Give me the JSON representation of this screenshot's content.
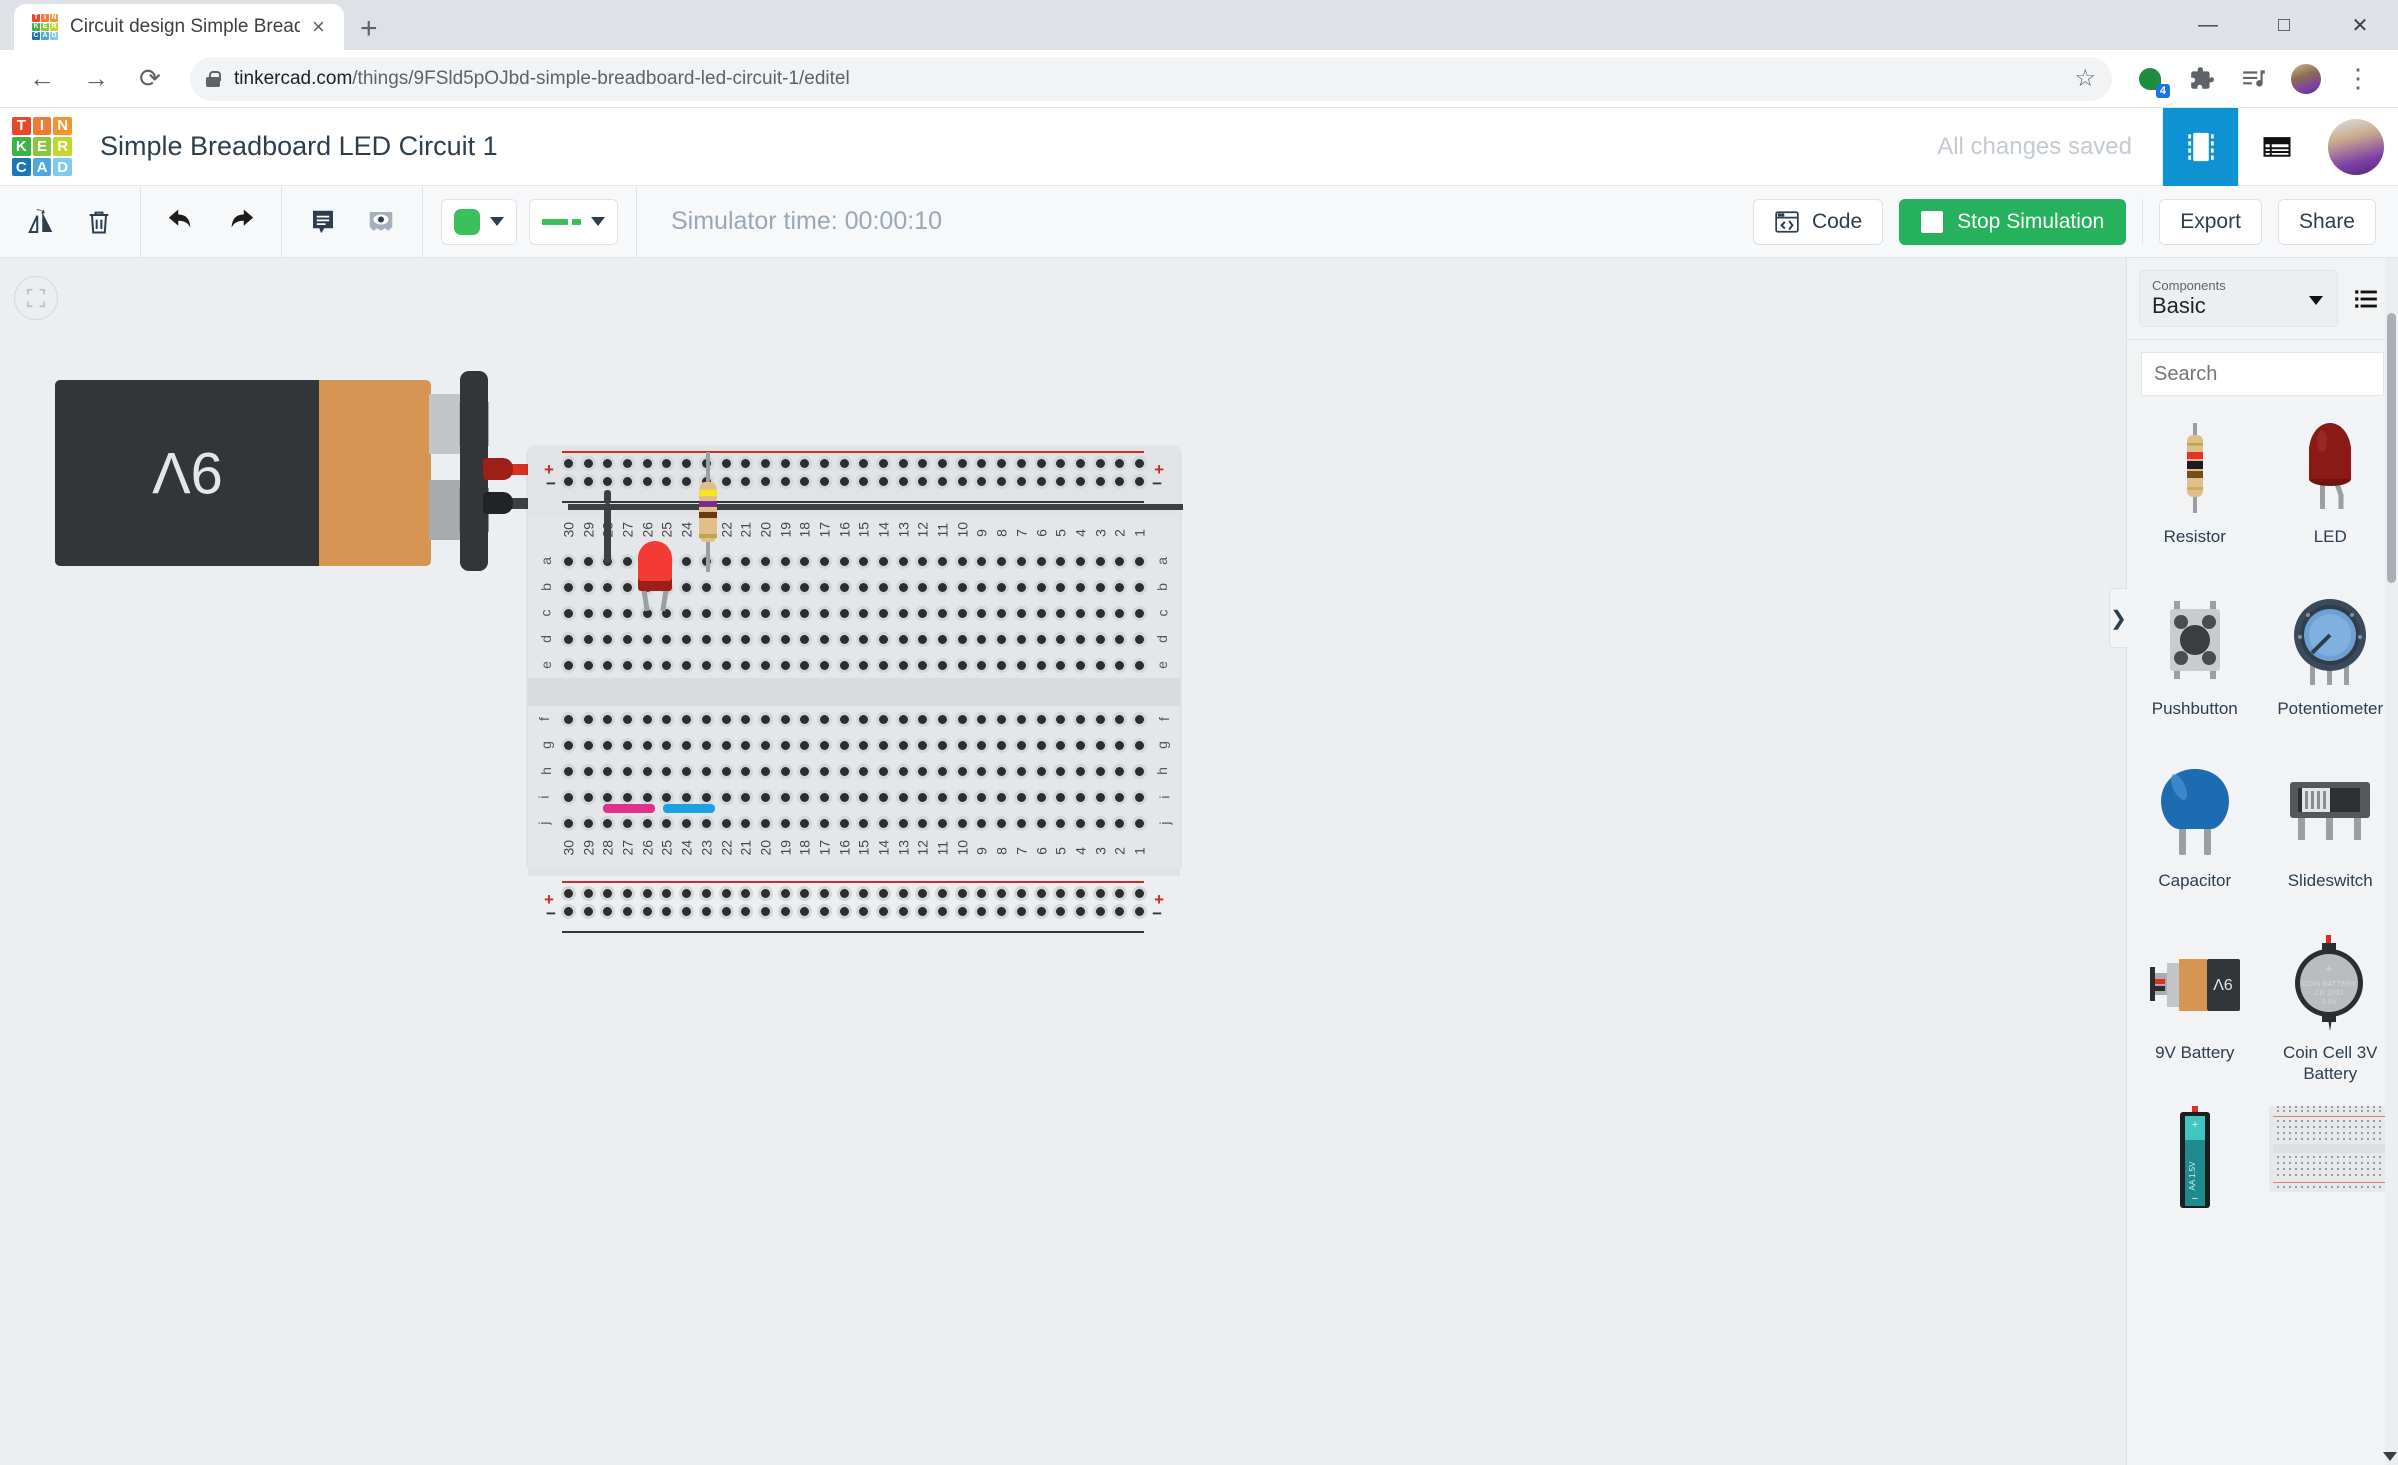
{
  "browser": {
    "tab": {
      "title": "Circuit design Simple Breadboard",
      "close_label": "×",
      "favicon_letters": [
        "T",
        "I",
        "N",
        "K",
        "E",
        "R",
        "C",
        "A",
        "D"
      ]
    },
    "newtab_label": "+",
    "window_controls": {
      "minimize": "—",
      "maximize": "□",
      "close": "✕"
    },
    "nav": {
      "back": "←",
      "forward": "→",
      "reload": "⟳"
    },
    "url_domain": "tinkercad.com",
    "url_path": "/things/9FSld5pOJbd-simple-breadboard-led-circuit-1/editel",
    "bookmark_label": "☆",
    "extension_badge": "4",
    "menu_label": "⋮"
  },
  "header": {
    "logo_letters": [
      "T",
      "I",
      "N",
      "K",
      "E",
      "R",
      "C",
      "A",
      "D"
    ],
    "logo_colors": [
      "#e8472b",
      "#f07a38",
      "#f59331",
      "#3db44a",
      "#8cc63f",
      "#c4d52e",
      "#1b75bb",
      "#4fa8dd",
      "#7ecbf0"
    ],
    "title": "Simple Breadboard LED Circuit 1",
    "save_status": "All changes saved",
    "view_circuit_label": "circuit-view-icon",
    "view_list_label": "list-view-icon"
  },
  "toolbar": {
    "rotate_label": "Rotate",
    "delete_label": "Delete",
    "undo_label": "Undo",
    "redo_label": "Redo",
    "notes_label": "Notes",
    "visibility_label": "Show/Hide",
    "color_value": "#3ac15b",
    "wire_color_value": "#3ac15b",
    "simulator_time": "Simulator time: 00:00:10",
    "code_label": "Code",
    "stop_label": "Stop Simulation",
    "stop_color": "#26b25d",
    "export_label": "Export",
    "share_label": "Share"
  },
  "canvas": {
    "fit_label": "Fit to view",
    "battery": {
      "label": "9V"
    },
    "breadboard": {
      "columns_top": [
        "30",
        "29",
        "28",
        "27",
        "26",
        "25",
        "24",
        "23",
        "22",
        "21",
        "20",
        "19",
        "18",
        "17",
        "16",
        "15",
        "14",
        "13",
        "12",
        "11",
        "10",
        "9",
        "8",
        "7",
        "6",
        "5",
        "4",
        "3",
        "2",
        "1"
      ],
      "rows_upper": [
        "a",
        "b",
        "c",
        "d",
        "e"
      ],
      "rows_lower": [
        "f",
        "g",
        "h",
        "i",
        "j"
      ],
      "rail_plus": "+",
      "rail_minus": "−"
    },
    "components_on_board": [
      {
        "name": "LED",
        "color": "#f43a34"
      },
      {
        "name": "Resistor",
        "bands": [
          "#f5e620",
          "#7b2d8e",
          "#6b3a12",
          "#b9a84a"
        ]
      },
      {
        "name": "Jumper wire pink",
        "color": "#e0308e"
      },
      {
        "name": "Jumper wire blue",
        "color": "#1aa3e0"
      }
    ]
  },
  "panel": {
    "collapse_label": "❯",
    "select_label": "Components",
    "select_value": "Basic",
    "list_view_label": "list-view-icon",
    "search_placeholder": "Search",
    "components": [
      {
        "name": "Resistor",
        "art": "resistor"
      },
      {
        "name": "LED",
        "art": "led"
      },
      {
        "name": "Pushbutton",
        "art": "pushbutton"
      },
      {
        "name": "Potentiometer",
        "art": "potentiometer"
      },
      {
        "name": "Capacitor",
        "art": "capacitor"
      },
      {
        "name": "Slideswitch",
        "art": "slideswitch"
      },
      {
        "name": "9V Battery",
        "art": "battery9v"
      },
      {
        "name": "Coin Cell 3V Battery",
        "art": "coincell"
      },
      {
        "name": "",
        "art": "aabattery"
      },
      {
        "name": "",
        "art": "breadboard"
      }
    ],
    "coin_cell_text": [
      "COIN BATTERY",
      "CR 2032",
      "3.0V"
    ],
    "battery9v_label": "9V",
    "aa_label": "AA 1.5V"
  }
}
